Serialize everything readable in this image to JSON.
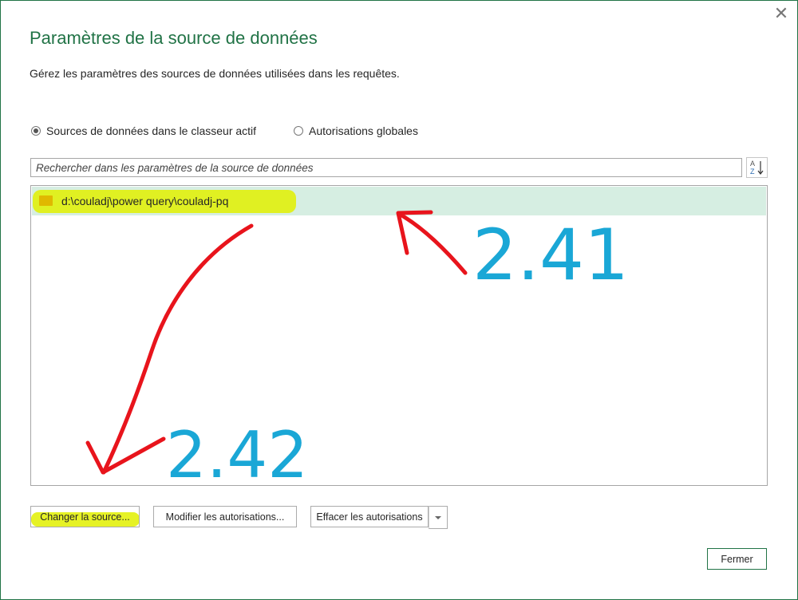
{
  "dialog": {
    "title": "Paramètres de la source de données",
    "subtitle": "Gérez les paramètres des sources de données utilisées dans les requêtes.",
    "close_icon": "close-icon"
  },
  "scope": {
    "options": [
      {
        "label": "Sources de données dans le classeur actif",
        "selected": true
      },
      {
        "label": "Autorisations globales",
        "selected": false
      }
    ]
  },
  "search": {
    "placeholder": "Rechercher dans les paramètres de la source de données",
    "value": ""
  },
  "sort_icon": "sort-az-icon",
  "list": {
    "items": [
      {
        "label": "d:\\couladj\\power query\\couladj-pq",
        "icon": "folder-icon",
        "selected": true
      }
    ]
  },
  "buttons": {
    "change_source": "Changer la source...",
    "edit_permissions": "Modifier les autorisations...",
    "clear_permissions": "Effacer les autorisations",
    "close": "Fermer"
  },
  "annotations": {
    "label_1": "2.41",
    "label_2": "2.42",
    "arrow_color": "#e8141c",
    "number_color": "#1aa7d6",
    "highlight_color": "#e2f000"
  },
  "colors": {
    "accent": "#217346",
    "selection": "#d6eee2"
  }
}
